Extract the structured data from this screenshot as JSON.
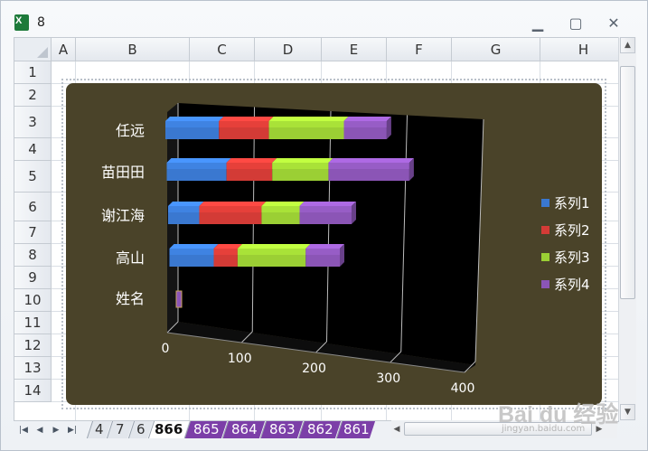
{
  "window": {
    "title": "8"
  },
  "columns": [
    "A",
    "B",
    "C",
    "D",
    "E",
    "F",
    "G",
    "H"
  ],
  "rows": [
    "1",
    "2",
    "3",
    "4",
    "5",
    "6",
    "7",
    "8",
    "9",
    "10",
    "11",
    "12",
    "13",
    "14"
  ],
  "sheet_tabs": [
    "4",
    "7",
    "6",
    "866",
    "865",
    "864",
    "863",
    "862",
    "861"
  ],
  "active_tab": "866",
  "watermark": {
    "main": "Bai du 经验",
    "sub": "jingyan.baidu.com"
  },
  "chart_data": {
    "type": "bar",
    "stacked": true,
    "orientation": "horizontal",
    "3d": true,
    "categories": [
      "任远",
      "苗田田",
      "谢江海",
      "高山",
      "姓名"
    ],
    "series": [
      {
        "name": "系列1",
        "color": "#3a78d0",
        "values": [
          75,
          85,
          45,
          65,
          0
        ]
      },
      {
        "name": "系列2",
        "color": "#d33b36",
        "values": [
          70,
          65,
          90,
          35,
          0
        ]
      },
      {
        "name": "系列3",
        "color": "#9bcf34",
        "values": [
          105,
          80,
          55,
          100,
          0
        ]
      },
      {
        "name": "系列4",
        "color": "#8b55b6",
        "values": [
          60,
          115,
          75,
          50,
          0
        ]
      }
    ],
    "xaxis_ticks": [
      "0",
      "100",
      "200",
      "300",
      "400"
    ],
    "xlim": [
      0,
      400
    ],
    "grid": true,
    "legend": "right",
    "background": "#4a4329",
    "plot_background": "#000000",
    "text_color": "#ffffff"
  }
}
